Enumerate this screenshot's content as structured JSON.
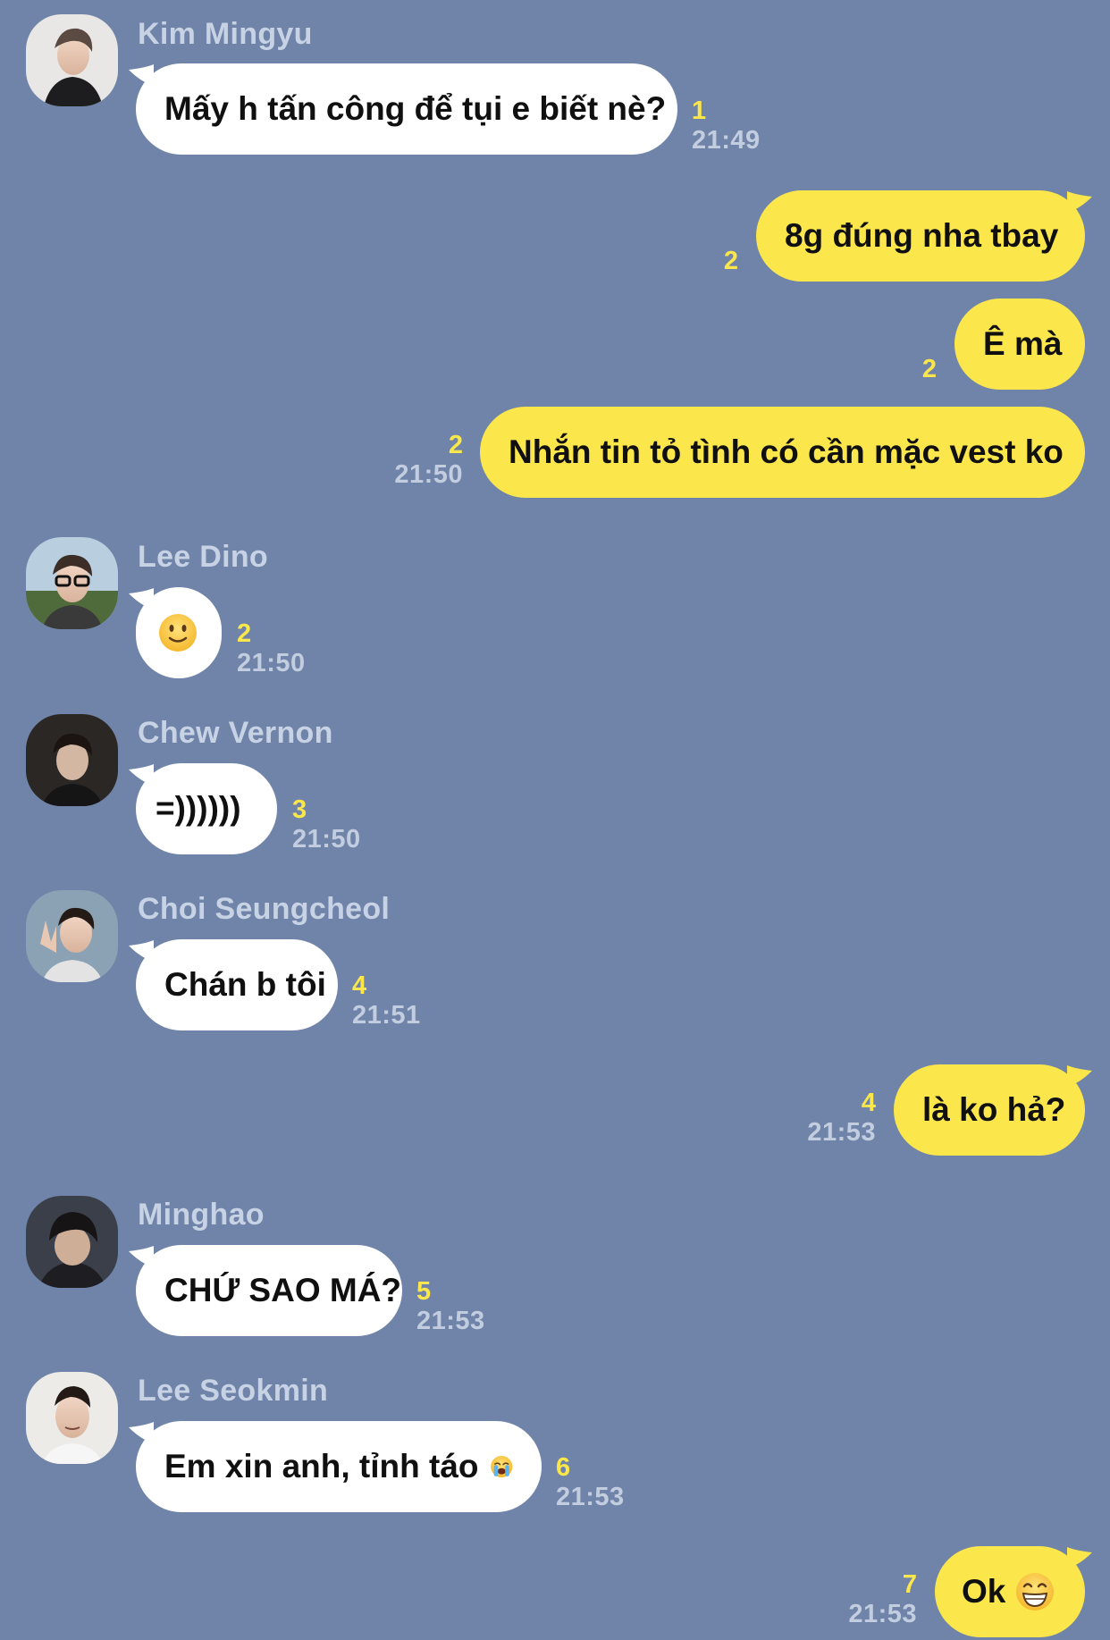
{
  "colors": {
    "background": "#6f84a8",
    "incoming_bubble": "#ffffff",
    "outgoing_bubble": "#fbe64b",
    "read_count": "#fbe64b",
    "timestamp": "#c2cde0",
    "sender_name": "#c7d2e5"
  },
  "messages": [
    {
      "direction": "incoming",
      "sender": "Kim Mingyu",
      "avatar_icon": "profile-photo-icon",
      "text": "Mấy h tấn công để tụi e biết nè?",
      "unread": "1",
      "time": "21:49"
    },
    {
      "direction": "outgoing",
      "text": "8g đúng nha tbay",
      "unread": "2",
      "time": ""
    },
    {
      "direction": "outgoing",
      "text": "Ê mà",
      "unread": "2",
      "time": ""
    },
    {
      "direction": "outgoing",
      "text": "Nhắn tin tỏ tình có cần mặc vest ko",
      "unread": "2",
      "time": "21:50"
    },
    {
      "direction": "incoming",
      "sender": "Lee Dino",
      "avatar_icon": "profile-photo-icon",
      "text": "",
      "emoji": "slightly-smiling-face-emoji",
      "unread": "2",
      "time": "21:50"
    },
    {
      "direction": "incoming",
      "sender": "Chew Vernon",
      "avatar_icon": "profile-photo-icon",
      "text": "=))))))",
      "unread": "3",
      "time": "21:50"
    },
    {
      "direction": "incoming",
      "sender": "Choi Seungcheol",
      "avatar_icon": "profile-photo-icon",
      "text": "Chán b tôi",
      "unread": "4",
      "time": "21:51"
    },
    {
      "direction": "outgoing",
      "text": "là ko hả?",
      "unread": "4",
      "time": "21:53"
    },
    {
      "direction": "incoming",
      "sender": "Minghao",
      "avatar_icon": "profile-photo-icon",
      "text": "CHỨ SAO MÁ?",
      "unread": "5",
      "time": "21:53"
    },
    {
      "direction": "incoming",
      "sender": "Lee Seokmin",
      "avatar_icon": "profile-photo-icon",
      "text": "Em xin anh, tỉnh táo",
      "emoji": "loudly-crying-face-emoji",
      "unread": "6",
      "time": "21:53"
    },
    {
      "direction": "outgoing",
      "text": "Ok",
      "emoji": "grinning-face-emoji",
      "unread": "7",
      "time": "21:53"
    }
  ]
}
